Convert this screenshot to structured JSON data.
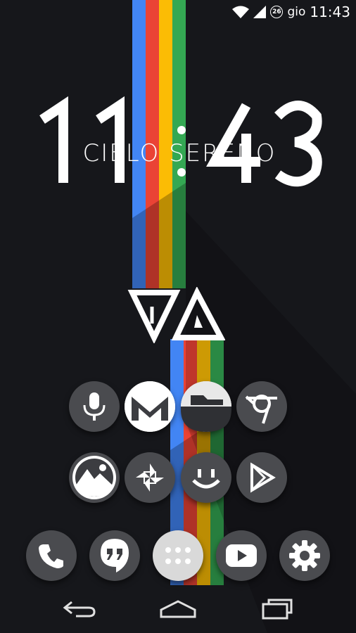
{
  "status_bar": {
    "notification_count": "26",
    "day": "gio",
    "time": "11:43"
  },
  "clock_widget": {
    "time": "11:43",
    "weather": "CIELO SERENO"
  },
  "colors": {
    "background": "#16171b",
    "stripe_blue": "#4285f4",
    "stripe_red": "#ea4335",
    "stripe_yellow": "#fbbc05",
    "stripe_green": "#34a853",
    "icon_bg": "#4a4b4f"
  },
  "home_icons": [
    {
      "name": "voice-search-icon"
    },
    {
      "name": "gmail-icon"
    },
    {
      "name": "file-manager-icon"
    },
    {
      "name": "chrome-icon"
    },
    {
      "name": "gallery-icon"
    },
    {
      "name": "photos-icon"
    },
    {
      "name": "messenger-icon"
    },
    {
      "name": "play-store-icon"
    }
  ],
  "dock_icons": [
    {
      "name": "phone-icon"
    },
    {
      "name": "hangouts-icon"
    },
    {
      "name": "app-drawer-icon"
    },
    {
      "name": "youtube-icon"
    },
    {
      "name": "settings-icon"
    }
  ],
  "nav_bar": [
    "back-icon",
    "home-icon",
    "recents-icon"
  ]
}
